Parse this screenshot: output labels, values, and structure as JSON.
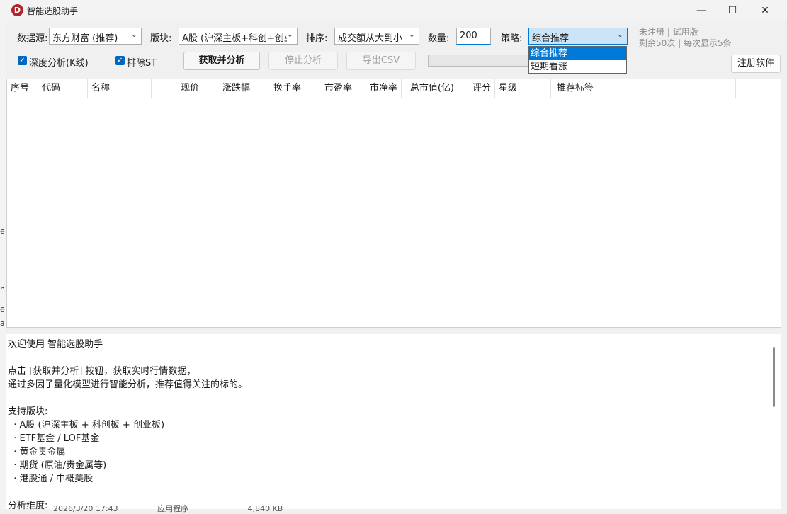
{
  "window": {
    "title": "智能选股助手",
    "logo_letter": "D"
  },
  "toolbar": {
    "source_label": "数据源:",
    "source_value": "东方财富 (推荐)",
    "board_label": "版块:",
    "board_value": "A股 (沪深主板+科创+创业",
    "sort_label": "排序:",
    "sort_value": "成交额从大到小",
    "count_label": "数量:",
    "count_value": "200",
    "strategy_label": "策略:",
    "strategy_value": "综合推荐",
    "reg_status": "未注册 | 试用版",
    "reg_quota": "剩余50次 | 每次显示5条",
    "deep_analysis_label": "深度分析(K线)",
    "exclude_st_label": "排除ST",
    "fetch_button": "获取并分析",
    "stop_button": "停止分析",
    "export_button": "导出CSV",
    "register_button": "注册软件"
  },
  "strategy_options": [
    "综合推荐",
    "短期看涨"
  ],
  "table": {
    "columns": [
      "序号",
      "代码",
      "名称",
      "现价",
      "涨跌幅",
      "换手率",
      "市盈率",
      "市净率",
      "总市值(亿)",
      "评分",
      "星级",
      "推荐标签"
    ]
  },
  "log": {
    "lines": [
      "欢迎使用 智能选股助手",
      "",
      "点击 [获取并分析] 按钮，获取实时行情数据，",
      "通过多因子量化模型进行智能分析，推荐值得关注的标的。",
      "",
      "支持版块:",
      "  · A股 (沪深主板 + 科创板 + 创业板)",
      "  · ETF基金 / LOF基金",
      "  · 黄金贵金属",
      "  · 期货 (原油/贵金属等)",
      "  · 港股通 / 中概美股",
      "",
      "分析维度:"
    ]
  },
  "footer": {
    "date": "2026/3/20 17:43",
    "type": "应用程序",
    "size": "4,840 KB"
  },
  "colors": {
    "accent": "#0078d7",
    "logo": "#b3242c",
    "checkbox": "#0067c0"
  }
}
